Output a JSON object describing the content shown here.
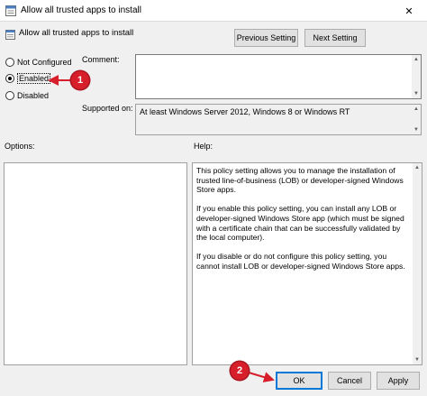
{
  "window": {
    "title": "Allow all trusted apps to install",
    "close_glyph": "✕",
    "minimize_glyph": "—"
  },
  "header": {
    "policy_name": "Allow all trusted apps to install",
    "previous_label": "Previous Setting",
    "next_label": "Next Setting"
  },
  "state": {
    "options": [
      {
        "label": "Not Configured",
        "checked": false
      },
      {
        "label": "Enabled",
        "checked": true
      },
      {
        "label": "Disabled",
        "checked": false
      }
    ]
  },
  "comment": {
    "label": "Comment:",
    "value": ""
  },
  "supported": {
    "label": "Supported on:",
    "value": "At least Windows Server 2012, Windows 8 or Windows RT"
  },
  "panes": {
    "options_label": "Options:",
    "help_label": "Help:"
  },
  "help": {
    "text": "This policy setting allows you to manage the installation of trusted line-of-business (LOB) or developer-signed Windows Store apps.\n\nIf you enable this policy setting, you can install any LOB or developer-signed Windows Store app (which must be signed with a certificate chain that can be successfully validated by the local computer).\n\nIf you disable or do not configure this policy setting, you cannot install LOB or developer-signed Windows Store apps."
  },
  "footer": {
    "ok_label": "OK",
    "cancel_label": "Cancel",
    "apply_label": "Apply"
  },
  "annotations": {
    "badge_1": "1",
    "badge_2": "2"
  },
  "colors": {
    "badge": "#d61f2b",
    "focus": "#0078d7"
  }
}
